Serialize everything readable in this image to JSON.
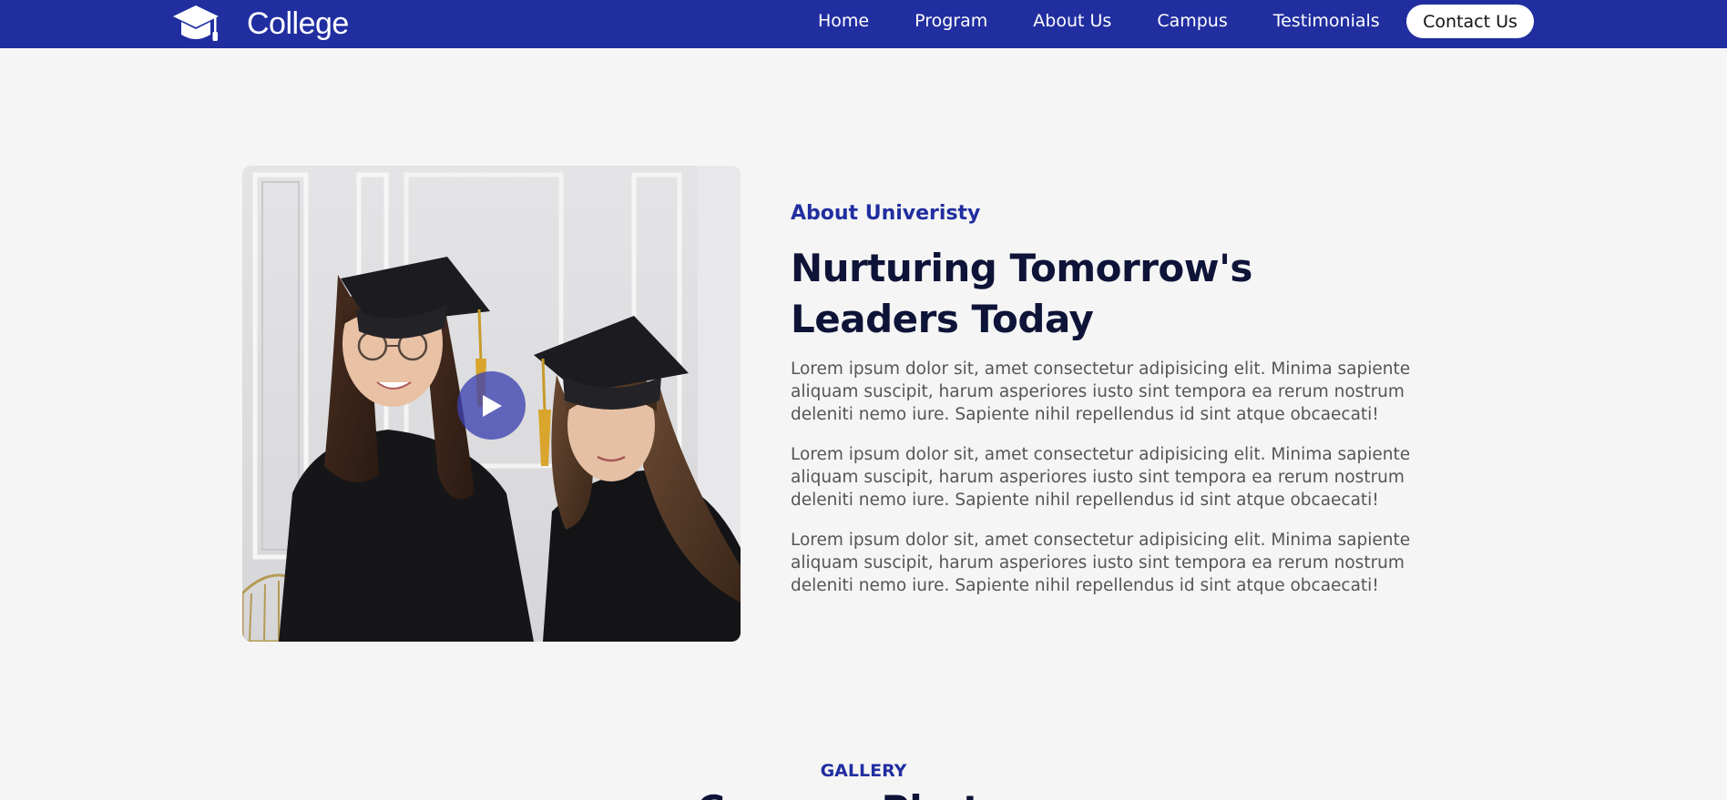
{
  "brand": {
    "name": "College",
    "logo_icon": "graduation-cap-icon",
    "nav_color": "#212ea0"
  },
  "nav": {
    "items": [
      {
        "label": "Home"
      },
      {
        "label": "Program"
      },
      {
        "label": "About Us"
      },
      {
        "label": "Campus"
      },
      {
        "label": "Testimonials"
      }
    ],
    "contact_label": "Contact Us"
  },
  "about": {
    "eyebrow": "About Univeristy",
    "heading": "Nurturing Tomorrow's Leaders Today",
    "paragraphs": [
      "Lorem ipsum dolor sit, amet consectetur adipisicing elit. Minima sapiente aliquam suscipit, harum asperiores iusto sint tempora ea rerum nostrum deleniti nemo iure. Sapiente nihil repellendus id sint atque obcaecati!",
      "Lorem ipsum dolor sit, amet consectetur adipisicing elit. Minima sapiente aliquam suscipit, harum asperiores iusto sint tempora ea rerum nostrum deleniti nemo iure. Sapiente nihil repellendus id sint atque obcaecati!",
      "Lorem ipsum dolor sit, amet consectetur adipisicing elit. Minima sapiente aliquam suscipit, harum asperiores iusto sint tempora ea rerum nostrum deleniti nemo iure. Sapiente nihil repellendus id sint atque obcaecati!"
    ],
    "media_icon": "play-icon"
  },
  "gallery": {
    "eyebrow": "GALLERY",
    "title": "Campus Photos"
  }
}
